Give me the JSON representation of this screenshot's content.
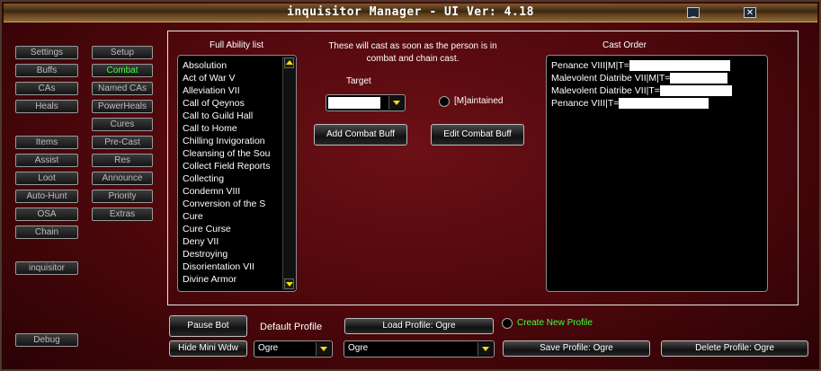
{
  "window": {
    "title": "inquisitor Manager   - UI Ver: 4.18",
    "minimize_icon": "minimize-icon",
    "close_icon": "close-icon"
  },
  "sidebar": {
    "col1": [
      "Settings",
      "Buffs",
      "CAs",
      "Heals",
      "Items",
      "Assist",
      "Loot",
      "Auto-Hunt",
      "OSA",
      "Chain"
    ],
    "col2": [
      "Setup",
      "Combat",
      "Named CAs",
      "PowerHeals",
      "Cures",
      "Pre-Cast",
      "Res",
      "Announce",
      "Priority",
      "Extras"
    ],
    "active": "Combat",
    "character": "inquisitor",
    "debug": "Debug"
  },
  "ability_list": {
    "label": "Full Ability list",
    "items": [
      "Absolution",
      "Act of War V",
      "Alleviation VII",
      "Call of Qeynos",
      "Call to Guild Hall",
      "Call to Home",
      "Chilling Invigoration",
      "Cleansing of the Sou",
      "Collect Field Reports",
      "Collecting",
      "Condemn VIII",
      "Conversion of the S",
      "Cure",
      "Cure Curse",
      "Deny VII",
      "Destroying",
      "Disorientation VII",
      "Divine Armor"
    ]
  },
  "info": {
    "text_line1": "These will cast as soon as the person is in",
    "text_line2": "combat and chain cast."
  },
  "target": {
    "label": "Target",
    "value": ""
  },
  "maintained": {
    "label": "[M]aintained"
  },
  "buttons": {
    "add_combat_buff": "Add Combat Buff",
    "edit_combat_buff": "Edit Combat Buff",
    "pause_bot": "Pause Bot",
    "hide_mini": "Hide Mini Wdw",
    "load_profile": "Load Profile: Ogre",
    "save_profile": "Save Profile: Ogre",
    "delete_profile": "Delete Profile: Ogre"
  },
  "cast_order": {
    "label": "Cast Order",
    "items": [
      "Penance VIII|M|T=",
      "Malevolent Diatribe VII|M|T=",
      "Malevolent Diatribe VII|T=",
      "Penance VIII|T="
    ]
  },
  "profile": {
    "default_label": "Default Profile",
    "default_value": "Ogre",
    "load_value": "Ogre",
    "create_new": "Create New Profile"
  },
  "colors": {
    "accent_green": "#43ff43",
    "background": "#5a0a0e"
  }
}
